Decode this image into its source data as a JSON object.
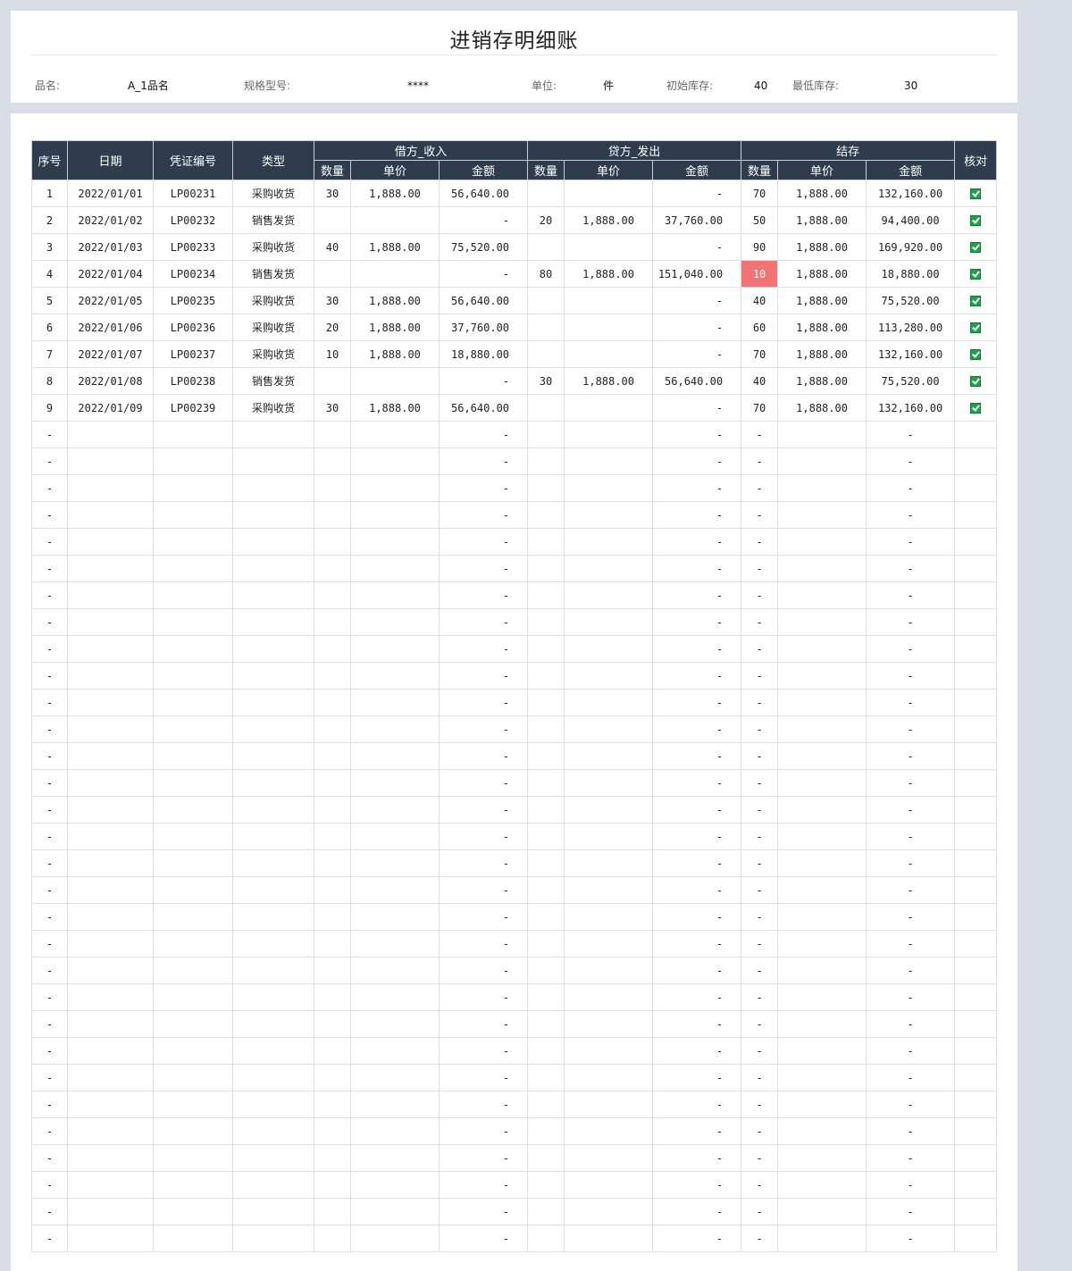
{
  "header": {
    "title": "进销存明细账",
    "fields": [
      {
        "label": "品名:",
        "value": "A_1品名"
      },
      {
        "label": "规格型号:",
        "value": "****"
      },
      {
        "label": "单位:",
        "value": "件"
      },
      {
        "label": "初始库存:",
        "value": "40"
      },
      {
        "label": "最低库存:",
        "value": "30"
      }
    ]
  },
  "table": {
    "columns": {
      "seq": "序号",
      "date": "日期",
      "voucher": "凭证编号",
      "type": "类型",
      "debit": "借方_收入",
      "credit": "贷方_发出",
      "balance": "结存",
      "check": "核对",
      "qty": "数量",
      "price": "单价",
      "amount": "金额"
    },
    "empty_marker": "-",
    "empty_row_count": 31,
    "rows": [
      {
        "seq": "1",
        "date": "2022/01/01",
        "voucher": "LP00231",
        "type": "采购收货",
        "in_qty": "30",
        "in_price": "1,888.00",
        "in_amount": "56,640.00",
        "out_qty": "",
        "out_price": "",
        "out_amount": "-",
        "bal_qty": "70",
        "bal_price": "1,888.00",
        "bal_amount": "132,160.00",
        "checked": true,
        "low": false
      },
      {
        "seq": "2",
        "date": "2022/01/02",
        "voucher": "LP00232",
        "type": "销售发货",
        "in_qty": "",
        "in_price": "",
        "in_amount": "-",
        "out_qty": "20",
        "out_price": "1,888.00",
        "out_amount": "37,760.00",
        "bal_qty": "50",
        "bal_price": "1,888.00",
        "bal_amount": "94,400.00",
        "checked": true,
        "low": false
      },
      {
        "seq": "3",
        "date": "2022/01/03",
        "voucher": "LP00233",
        "type": "采购收货",
        "in_qty": "40",
        "in_price": "1,888.00",
        "in_amount": "75,520.00",
        "out_qty": "",
        "out_price": "",
        "out_amount": "-",
        "bal_qty": "90",
        "bal_price": "1,888.00",
        "bal_amount": "169,920.00",
        "checked": true,
        "low": false
      },
      {
        "seq": "4",
        "date": "2022/01/04",
        "voucher": "LP00234",
        "type": "销售发货",
        "in_qty": "",
        "in_price": "",
        "in_amount": "-",
        "out_qty": "80",
        "out_price": "1,888.00",
        "out_amount": "151,040.00",
        "bal_qty": "10",
        "bal_price": "1,888.00",
        "bal_amount": "18,880.00",
        "checked": true,
        "low": true
      },
      {
        "seq": "5",
        "date": "2022/01/05",
        "voucher": "LP00235",
        "type": "采购收货",
        "in_qty": "30",
        "in_price": "1,888.00",
        "in_amount": "56,640.00",
        "out_qty": "",
        "out_price": "",
        "out_amount": "-",
        "bal_qty": "40",
        "bal_price": "1,888.00",
        "bal_amount": "75,520.00",
        "checked": true,
        "low": false
      },
      {
        "seq": "6",
        "date": "2022/01/06",
        "voucher": "LP00236",
        "type": "采购收货",
        "in_qty": "20",
        "in_price": "1,888.00",
        "in_amount": "37,760.00",
        "out_qty": "",
        "out_price": "",
        "out_amount": "-",
        "bal_qty": "60",
        "bal_price": "1,888.00",
        "bal_amount": "113,280.00",
        "checked": true,
        "low": false
      },
      {
        "seq": "7",
        "date": "2022/01/07",
        "voucher": "LP00237",
        "type": "采购收货",
        "in_qty": "10",
        "in_price": "1,888.00",
        "in_amount": "18,880.00",
        "out_qty": "",
        "out_price": "",
        "out_amount": "-",
        "bal_qty": "70",
        "bal_price": "1,888.00",
        "bal_amount": "132,160.00",
        "checked": true,
        "low": false
      },
      {
        "seq": "8",
        "date": "2022/01/08",
        "voucher": "LP00238",
        "type": "销售发货",
        "in_qty": "",
        "in_price": "",
        "in_amount": "-",
        "out_qty": "30",
        "out_price": "1,888.00",
        "out_amount": "56,640.00",
        "bal_qty": "40",
        "bal_price": "1,888.00",
        "bal_amount": "75,520.00",
        "checked": true,
        "low": false
      },
      {
        "seq": "9",
        "date": "2022/01/09",
        "voucher": "LP00239",
        "type": "采购收货",
        "in_qty": "30",
        "in_price": "1,888.00",
        "in_amount": "56,640.00",
        "out_qty": "",
        "out_price": "",
        "out_amount": "-",
        "bal_qty": "70",
        "bal_price": "1,888.00",
        "bal_amount": "132,160.00",
        "checked": true,
        "low": false
      }
    ]
  },
  "colors": {
    "header_bg": "#2e3c4e",
    "low_stock": "#f07474",
    "check": "#1fa24a",
    "page_bg": "#d9dde5"
  },
  "icons": {
    "check": "checkbox-checked-icon"
  }
}
